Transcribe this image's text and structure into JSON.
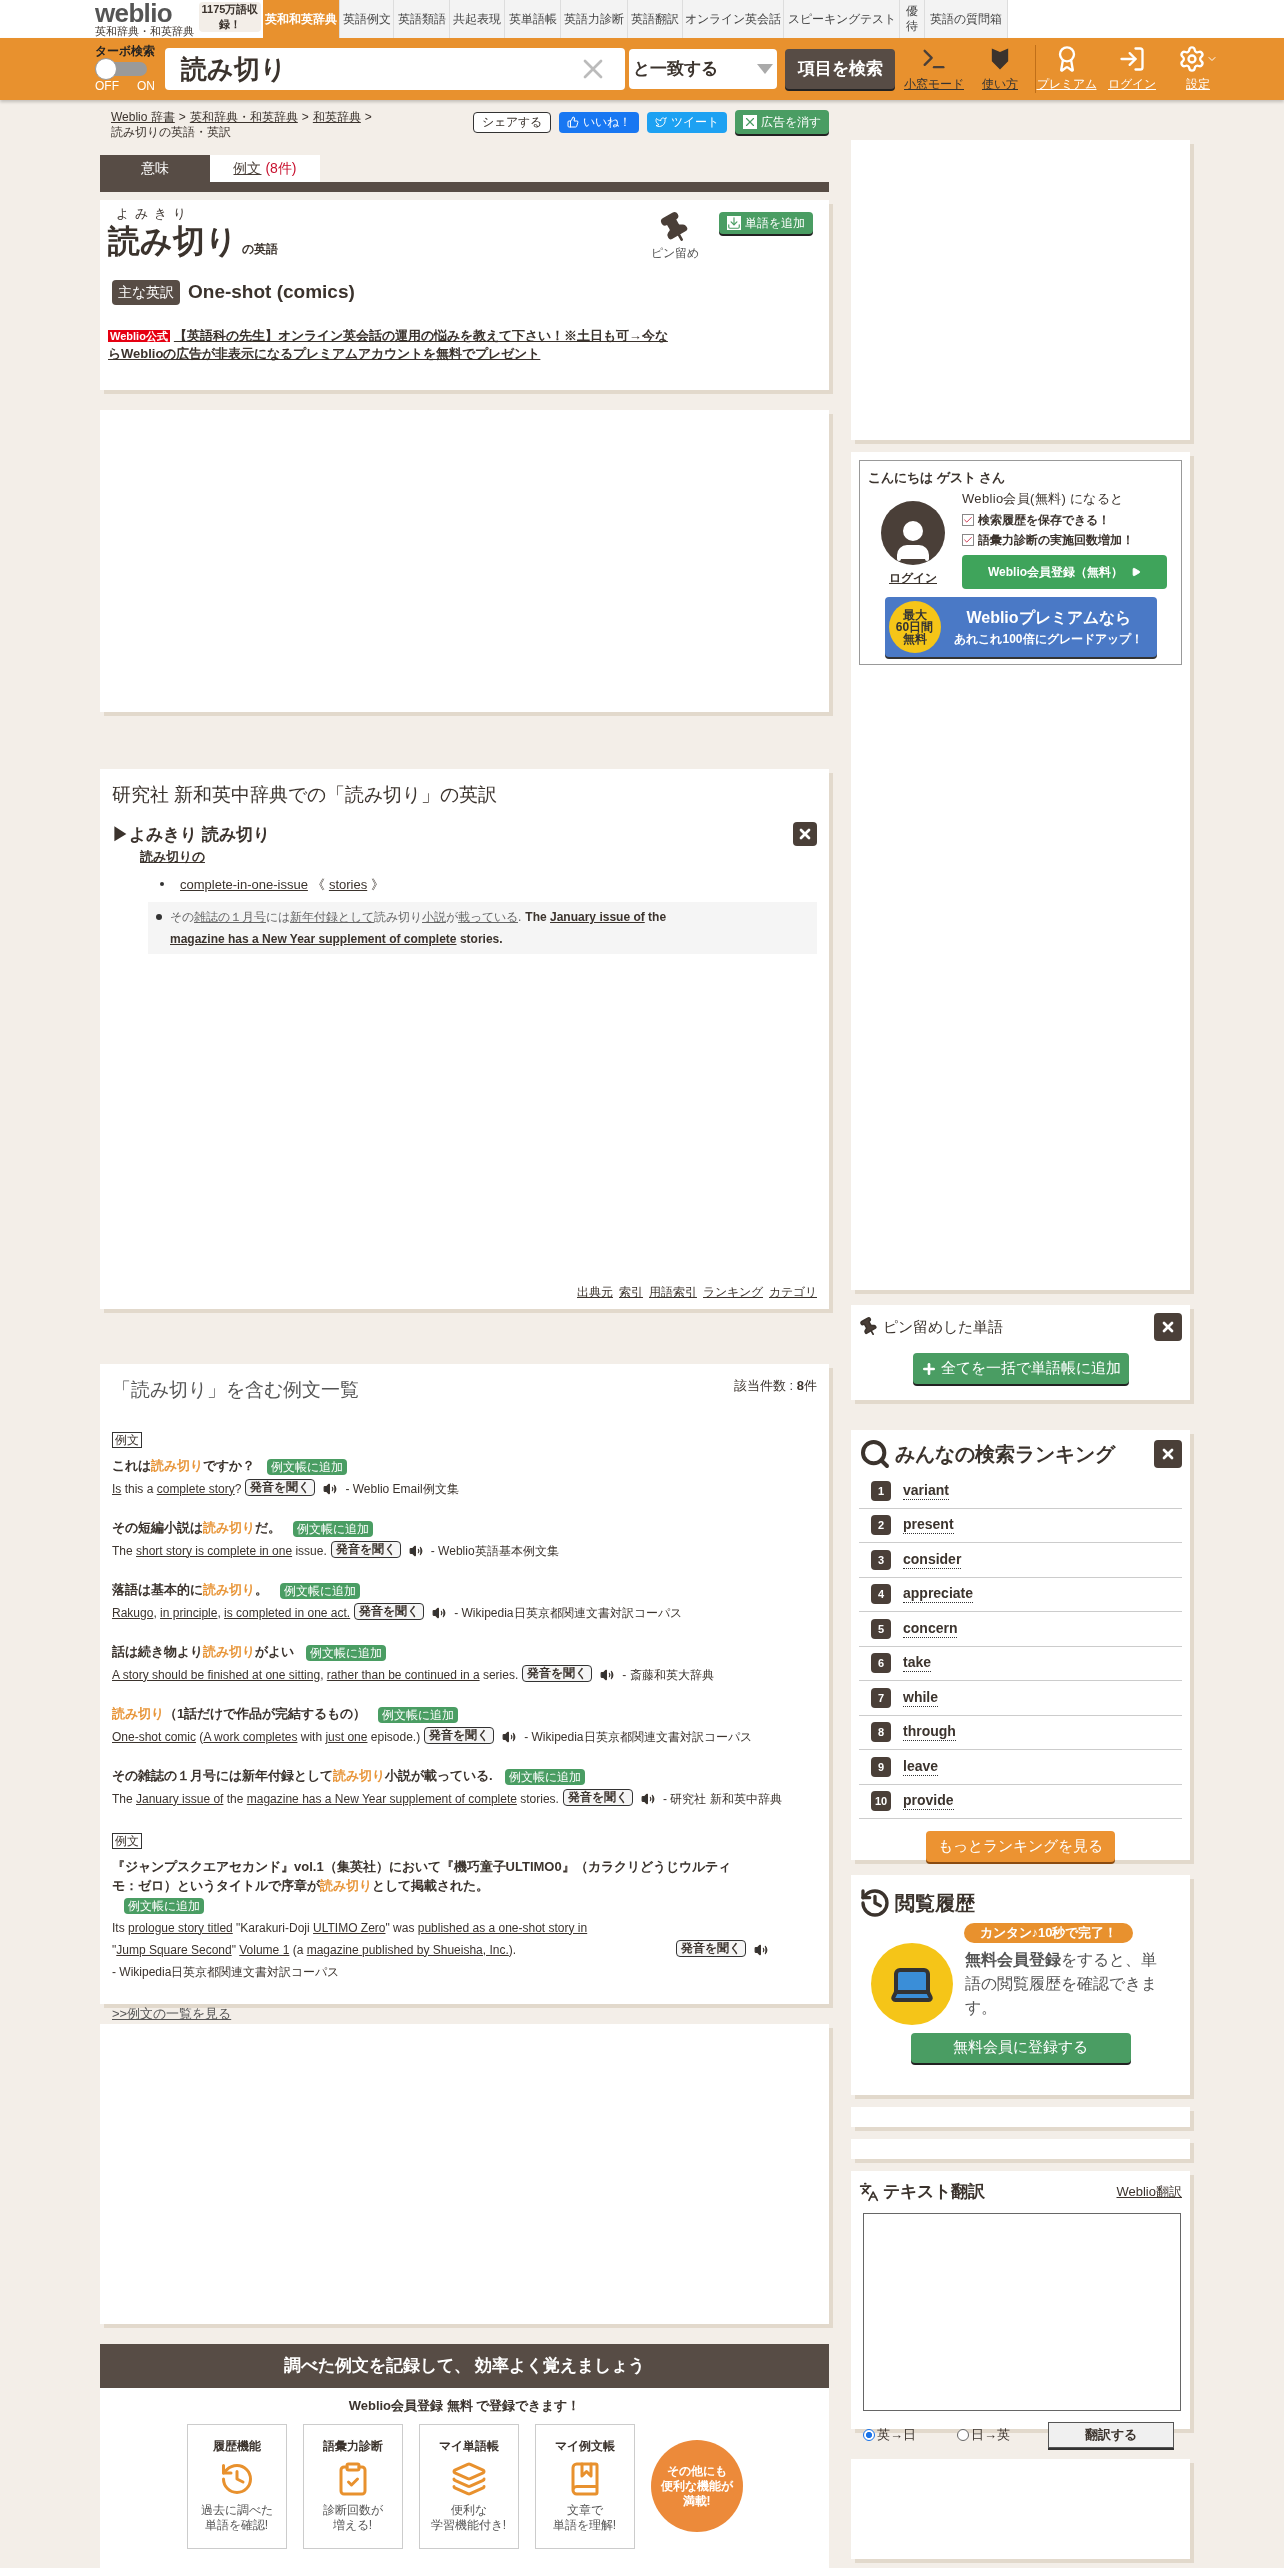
{
  "header": {
    "logo": "weblio",
    "logo_sub": "英和辞典・和英辞典",
    "word_count": "1175万語収録！",
    "nav": [
      {
        "label": "英和和英辞典",
        "selected": true
      },
      {
        "label": "英語例文",
        "selected": false
      },
      {
        "label": "英語類語",
        "selected": false
      },
      {
        "label": "共起表現",
        "selected": false
      },
      {
        "label": "英単語帳",
        "selected": false
      },
      {
        "label": "英語力診断",
        "selected": false
      },
      {
        "label": "英語翻訳",
        "selected": false
      },
      {
        "label": "オンライン英会話",
        "selected": false
      },
      {
        "label": "スピーキングテスト",
        "selected": false
      },
      {
        "label": "優待",
        "selected": false
      },
      {
        "label": "英語の質問箱",
        "selected": false
      }
    ]
  },
  "search_bar": {
    "turbo_label": "ターボ検索",
    "turbo_on": false,
    "off_label": "OFF",
    "on_label": "ON",
    "query": "読み切り",
    "match_mode": "と一致する",
    "search_button": "項目を検索",
    "tools": [
      {
        "kind": "window",
        "label": "小窓モード"
      },
      {
        "kind": "guide",
        "label": "使い方"
      },
      {
        "kind": "premium",
        "label": "プレミアム"
      },
      {
        "kind": "login",
        "label": "ログイン"
      },
      {
        "kind": "settings",
        "label": "設定"
      }
    ]
  },
  "breadcrumb": [
    {
      "label": "Weblio 辞書"
    },
    {
      "sep": ">",
      "label": "英和辞典・和英辞典"
    },
    {
      "sep": ">",
      "label": "和英辞典"
    },
    {
      "sep": ">",
      "label": "読み切りの英語・英訳"
    }
  ],
  "share_buttons": [
    {
      "kind": "share",
      "label": "シェアする"
    },
    {
      "kind": "like",
      "label": "いいね！"
    },
    {
      "kind": "tweet",
      "label": "ツイート"
    },
    {
      "kind": "remove_ads",
      "label": "広告を消す"
    }
  ],
  "tabs": [
    {
      "label": "意味",
      "selected": true
    },
    {
      "label": "例文",
      "count": "(8件)",
      "selected": false
    }
  ],
  "headword": {
    "reading": "よみきり",
    "word": "読み切り",
    "suffix": "の英語",
    "pin_label": "ピン留め",
    "add_button": "単語を追加",
    "main_label": "主な英訳",
    "main_translation": "One-shot (comics)",
    "ad_badge": "Weblio公式",
    "ad_text": "【英語科の先生】オンライン英会話の運用の悩みを教えて下さい！※土日も可→今ならWeblioの広告が非表示になるプレミアムアカウントを無料でプレゼント"
  },
  "dictionary": {
    "title": "研究社 新和英中辞典での「読み切り」の英訳",
    "entry": "▶よみきり 読み切り",
    "sense": "読み切りの",
    "translation": "complete-in-one-issue",
    "note_open": "《",
    "note": "stories",
    "note_close": "》",
    "example_jp": [
      {
        "t": "その",
        "u": false
      },
      {
        "t": "雑誌の１月号",
        "u": true
      },
      {
        "t": "には",
        "u": false
      },
      {
        "t": "新年付録として",
        "u": true
      },
      {
        "t": "読み切り",
        "u": false
      },
      {
        "t": "小説",
        "u": true
      },
      {
        "t": "が",
        "u": false
      },
      {
        "t": "載っている",
        "u": true
      },
      {
        "t": ".",
        "u": false
      }
    ],
    "example_en": [
      {
        "t": "The ",
        "u": false
      },
      {
        "t": "January issue of",
        "u": true
      },
      {
        "t": " the ",
        "u": false
      },
      {
        "t": "magazine has a New Year supplement of complete",
        "u": true
      },
      {
        "t": " stories.",
        "u": false
      }
    ],
    "footer_links": [
      "出典元",
      "索引",
      "用語索引",
      "ランキング",
      "カテゴリ"
    ]
  },
  "examples": {
    "title": "「読み切り」を含む例文一覧",
    "count": "該当件数 : **8**件",
    "more_link": ">>例文の一覧を見る",
    "groups": [
      {
        "label": "例文",
        "items": [
          {
            "jp": [
              {
                "t": "これは",
                "hl": false
              },
              {
                "t": "読み切り",
                "hl": true
              },
              {
                "t": "ですか？",
                "hl": false
              }
            ],
            "en": [
              {
                "t": "Is",
                "u": true
              },
              {
                "t": " this a ",
                "u": false
              },
              {
                "t": "complete story",
                "u": true
              },
              {
                "t": "?",
                "u": false
              }
            ],
            "add": "例文帳に追加",
            "listen": "発音を聞く",
            "source": "- Weblio Email例文集"
          },
          {
            "jp": [
              {
                "t": "その短編小説は",
                "hl": false
              },
              {
                "t": "読み切り",
                "hl": true
              },
              {
                "t": "だ。",
                "hl": false
              }
            ],
            "en": [
              {
                "t": "The ",
                "u": false
              },
              {
                "t": "short story is complete in one",
                "u": true
              },
              {
                "t": " issue.",
                "u": false
              }
            ],
            "add": "例文帳に追加",
            "listen": "発音を聞く",
            "source": "- Weblio英語基本例文集"
          },
          {
            "jp": [
              {
                "t": "落語は基本的に",
                "hl": false
              },
              {
                "t": "読み切り",
                "hl": true
              },
              {
                "t": "。",
                "hl": false
              }
            ],
            "en": [
              {
                "t": "Rakugo",
                "u": true
              },
              {
                "t": ", ",
                "u": false
              },
              {
                "t": "in principle",
                "u": true
              },
              {
                "t": ", ",
                "u": false
              },
              {
                "t": "is completed in one act.",
                "u": true
              }
            ],
            "add": "例文帳に追加",
            "listen": "発音を聞く",
            "source": "- Wikipedia日英京都関連文書対訳コーパス"
          },
          {
            "jp": [
              {
                "t": "話は続き物より",
                "hl": false
              },
              {
                "t": "読み切り",
                "hl": true
              },
              {
                "t": "がよい",
                "hl": false
              }
            ],
            "en": [
              {
                "t": "A story should be finished at one sitting",
                "u": true
              },
              {
                "t": ", ",
                "u": false
              },
              {
                "t": "rather than be continued in a",
                "u": true
              },
              {
                "t": " series.",
                "u": false
              }
            ],
            "add": "例文帳に追加",
            "listen": "発音を聞く",
            "source": "- 斎藤和英大辞典"
          },
          {
            "jp": [
              {
                "t": "読み切り",
                "hl": true
              },
              {
                "t": "（1話だけで作品が完結するもの）",
                "hl": false
              }
            ],
            "en": [
              {
                "t": "One-shot comic",
                "u": true
              },
              {
                "t": " (",
                "u": false
              },
              {
                "t": "A work completes",
                "u": true
              },
              {
                "t": " with ",
                "u": false
              },
              {
                "t": "just one",
                "u": true
              },
              {
                "t": " episode.)",
                "u": false
              }
            ],
            "add": "例文帳に追加",
            "listen": "発音を聞く",
            "source": "- Wikipedia日英京都関連文書対訳コーパス"
          },
          {
            "jp": [
              {
                "t": "その雑誌の１月号には新年付録として",
                "hl": false
              },
              {
                "t": "読み切り",
                "hl": true
              },
              {
                "t": "小説が載っている.",
                "hl": false
              }
            ],
            "en": [
              {
                "t": "The ",
                "u": false
              },
              {
                "t": "January issue of",
                "u": true
              },
              {
                "t": " the ",
                "u": false
              },
              {
                "t": "magazine has a New Year supplement of complete",
                "u": true
              },
              {
                "t": " stories.",
                "u": false
              }
            ],
            "add": "例文帳に追加",
            "listen": "発音を聞く",
            "source": "- 研究社 新和英中辞典"
          }
        ]
      },
      {
        "label": "例文",
        "items": [
          {
            "jp": [
              {
                "t": "『ジャンプスクエアセカンド』vol.1（集英社）において『機巧童子ULTIMO0』（カラクリどうじウルティモ：ゼロ）というタイトルで序章が",
                "hl": false
              },
              {
                "t": "読み切り",
                "hl": true
              },
              {
                "t": "として掲載された。",
                "hl": false
              }
            ],
            "en": [
              {
                "t": "Its ",
                "u": false
              },
              {
                "t": "prologue story titled",
                "u": true
              },
              {
                "t": " \"Karakuri-Doji ",
                "u": false
              },
              {
                "t": "ULTIMO Zero",
                "u": true
              },
              {
                "t": "\" was ",
                "u": false
              },
              {
                "t": "published as a one-shot story in",
                "u": true
              },
              {
                "t": " \"",
                "u": false
              },
              {
                "t": "Jump Square Second",
                "u": true
              },
              {
                "t": "\" ",
                "u": false
              },
              {
                "t": "Volume 1",
                "u": true
              },
              {
                "t": " (a ",
                "u": false
              },
              {
                "t": "magazine published by Shueisha, Inc.",
                "u": true
              },
              {
                "t": ").",
                "u": false
              }
            ],
            "add": "例文帳に追加",
            "listen": "発音を聞く",
            "source": "- Wikipedia日英京都関連文書対訳コーパス"
          }
        ]
      }
    ]
  },
  "member_box": {
    "greeting": "こんにちは ゲスト さん",
    "login": "ログイン",
    "invite": "Weblio会員(無料) になると",
    "benefits": [
      "検索履歴を保存できる！",
      "語彙力診断の実施回数増加！"
    ],
    "register_button": "Weblio会員登録（無料）",
    "premium_badge": [
      "最大",
      "60日間",
      "無料"
    ],
    "premium_title": "Weblioプレミアムなら",
    "premium_sub": "あれこれ**100倍**にグレードアップ！"
  },
  "pinned": {
    "title": "ピン留めした単語",
    "add_all": "全てを一括で単語帳に追加"
  },
  "ranking": {
    "title": "みんなの検索ランキング",
    "items": [
      {
        "rank": "1",
        "word": "variant"
      },
      {
        "rank": "2",
        "word": "present"
      },
      {
        "rank": "3",
        "word": "consider"
      },
      {
        "rank": "4",
        "word": "appreciate"
      },
      {
        "rank": "5",
        "word": "concern"
      },
      {
        "rank": "6",
        "word": "take"
      },
      {
        "rank": "7",
        "word": "while"
      },
      {
        "rank": "8",
        "word": "through"
      },
      {
        "rank": "9",
        "word": "leave"
      },
      {
        "rank": "10",
        "word": "provide"
      }
    ],
    "more_button": "もっとランキングを見る"
  },
  "history": {
    "title": "閲覧履歴",
    "ribbon": "カンタン♪10秒で完了！",
    "text": "**無料会員登録**をすると、単語の閲覧履歴を確認できます。",
    "button": "無料会員に登録する"
  },
  "translator": {
    "title": "テキスト翻訳",
    "link": "Weblio翻訳",
    "directions": [
      {
        "label": "英→日",
        "selected": true
      },
      {
        "label": "日→英",
        "selected": false
      }
    ],
    "button": "翻訳する"
  },
  "promo": {
    "title": "調べた例文を記録して、 効率よく覚えましょう",
    "subtitle": "Weblio会員登録 **無料** で登録できます！",
    "features": [
      {
        "kind": "history",
        "title": "履歴機能",
        "desc": [
          "過去に調べた",
          "単語を確認!"
        ]
      },
      {
        "kind": "diagnosis",
        "title": "語彙力診断",
        "desc": [
          "診断回数が",
          "増える!"
        ]
      },
      {
        "kind": "wordbook",
        "title": "マイ単語帳",
        "desc": [
          "便利な",
          "学習機能付き!"
        ]
      },
      {
        "kind": "examples",
        "title": "マイ例文帳",
        "desc": [
          "文章で",
          "単語を理解!"
        ]
      }
    ],
    "more_badge": [
      "その他にも",
      "便利な機能が",
      "満載!"
    ]
  }
}
